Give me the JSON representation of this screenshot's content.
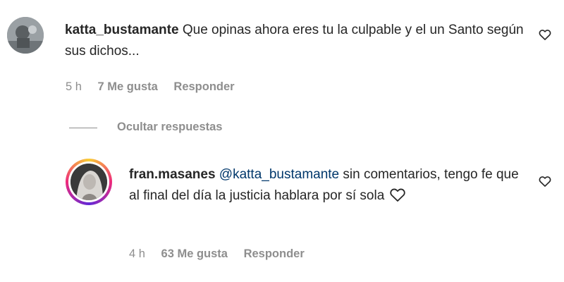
{
  "comments": [
    {
      "username": "katta_bustamante",
      "text": "Que opinas ahora eres tu la culpable y el un Santo según sus dichos...",
      "time": "5 h",
      "likes": "7 Me gusta",
      "reply_label": "Responder"
    },
    {
      "username": "fran.masanes",
      "mention": "@katta_bustamante",
      "text": "sin comentarios, tengo fe que al final del día la justicia hablara por sí sola",
      "time": "4 h",
      "likes": "63 Me gusta",
      "reply_label": "Responder"
    }
  ],
  "replies_toggle_label": "Ocultar respuestas",
  "icons": {
    "like": "heart-outline-icon",
    "emoji": "heart-outline-icon"
  },
  "colors": {
    "text": "#262626",
    "muted": "#8e8e8e",
    "mention": "#00376b"
  }
}
